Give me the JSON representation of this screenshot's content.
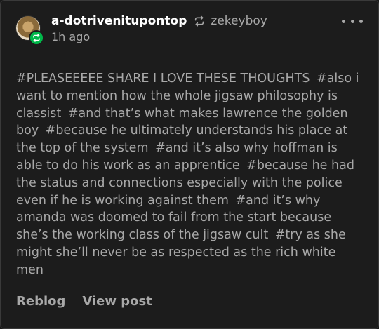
{
  "post": {
    "author": "a-dotrivenitupontop",
    "reblogged_from": "zekeyboy",
    "time": "1h ago",
    "more_icon": "ellipsis-icon",
    "reblog_icon": "reblog-icon"
  },
  "tags": [
    "#PLEASEEEEE SHARE I LOVE THESE THOUGHTS",
    "#also i want to mention how the whole jigsaw philosophy is classist",
    "#and that’s what makes lawrence the golden boy",
    "#because he ultimately understands his place at the top of the system",
    "#and it’s also why hoffman is able to do his work as an apprentice",
    "#because he had the status and connections especially with the police even if he is working against them",
    "#and it’s why amanda was doomed to fail from the start because she’s the working class of the jigsaw cult",
    "#try as she might she’ll never be as respected as the rich white men"
  ],
  "actions": {
    "reblog": "Reblog",
    "view_post": "View post"
  },
  "colors": {
    "background": "#1c1c1c",
    "primary_text": "#ffffff",
    "secondary_text": "#a8a8a8",
    "reblog_badge": "#00b84a"
  }
}
